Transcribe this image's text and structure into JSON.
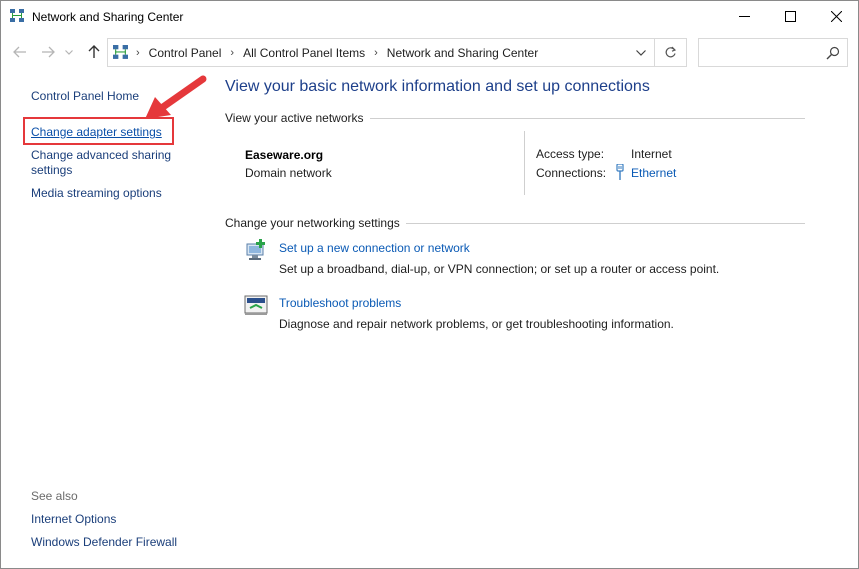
{
  "window": {
    "title": "Network and Sharing Center"
  },
  "address": {
    "crumbs": [
      "Control Panel",
      "All Control Panel Items",
      "Network and Sharing Center"
    ],
    "search_value": ""
  },
  "left_pane": {
    "home": "Control Panel Home",
    "adapter": "Change adapter settings",
    "advanced": "Change advanced sharing settings",
    "media": "Media streaming options",
    "see_also": "See also",
    "internet_options": "Internet Options",
    "firewall": "Windows Defender Firewall"
  },
  "main": {
    "title": "View your basic network information and set up connections",
    "active_networks_heading": "View your active networks",
    "network": {
      "name": "Easeware.org",
      "category": "Domain network",
      "access_label": "Access type:",
      "access_value": "Internet",
      "connections_label": "Connections:",
      "connection_value": "Ethernet"
    },
    "change_heading": "Change your networking settings",
    "tasks": [
      {
        "link": "Set up a new connection or network",
        "desc": "Set up a broadband, dial-up, or VPN connection; or set up a router or access point."
      },
      {
        "link": "Troubleshoot problems",
        "desc": "Diagnose and repair network problems, or get troubleshooting information."
      }
    ]
  },
  "icons": {
    "app": "network-icon",
    "minimize": "minimize-icon",
    "maximize": "maximize-icon",
    "close": "close-icon",
    "back": "back-arrow-icon",
    "forward": "forward-arrow-icon",
    "up": "up-arrow-icon",
    "refresh": "refresh-icon",
    "search": "search-icon",
    "ethernet": "ethernet-icon",
    "new_connection": "new-connection-icon",
    "troubleshoot": "troubleshoot-icon"
  },
  "colors": {
    "link": "#0a5ab5",
    "title": "#1d3f8a",
    "highlight": "#e5383b"
  }
}
